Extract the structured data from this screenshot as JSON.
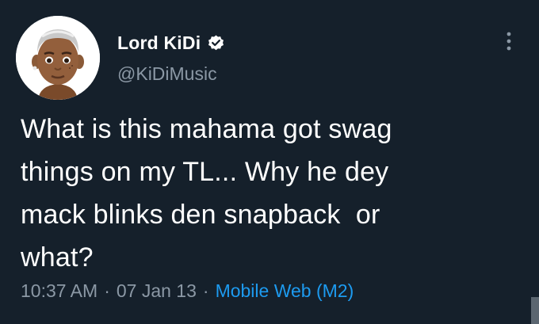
{
  "user": {
    "display_name": "Lord KiDi",
    "handle": "@KiDiMusic",
    "verified": true,
    "avatar": "memoji-avatar"
  },
  "tweet": {
    "text": "What is this mahama got swag\nthings on my TL... Why he dey\nmack blinks den snapback  or\nwhat?",
    "time": "10:37 AM",
    "date": "07 Jan 13",
    "separator": "·",
    "source": "Mobile Web (M2)"
  },
  "colors": {
    "background": "#15202b",
    "text": "#ffffff",
    "secondary": "#8b98a5",
    "link": "#1d9bf0"
  },
  "icons": {
    "more": "more-vertical-icon",
    "verified": "verified-badge-icon"
  }
}
